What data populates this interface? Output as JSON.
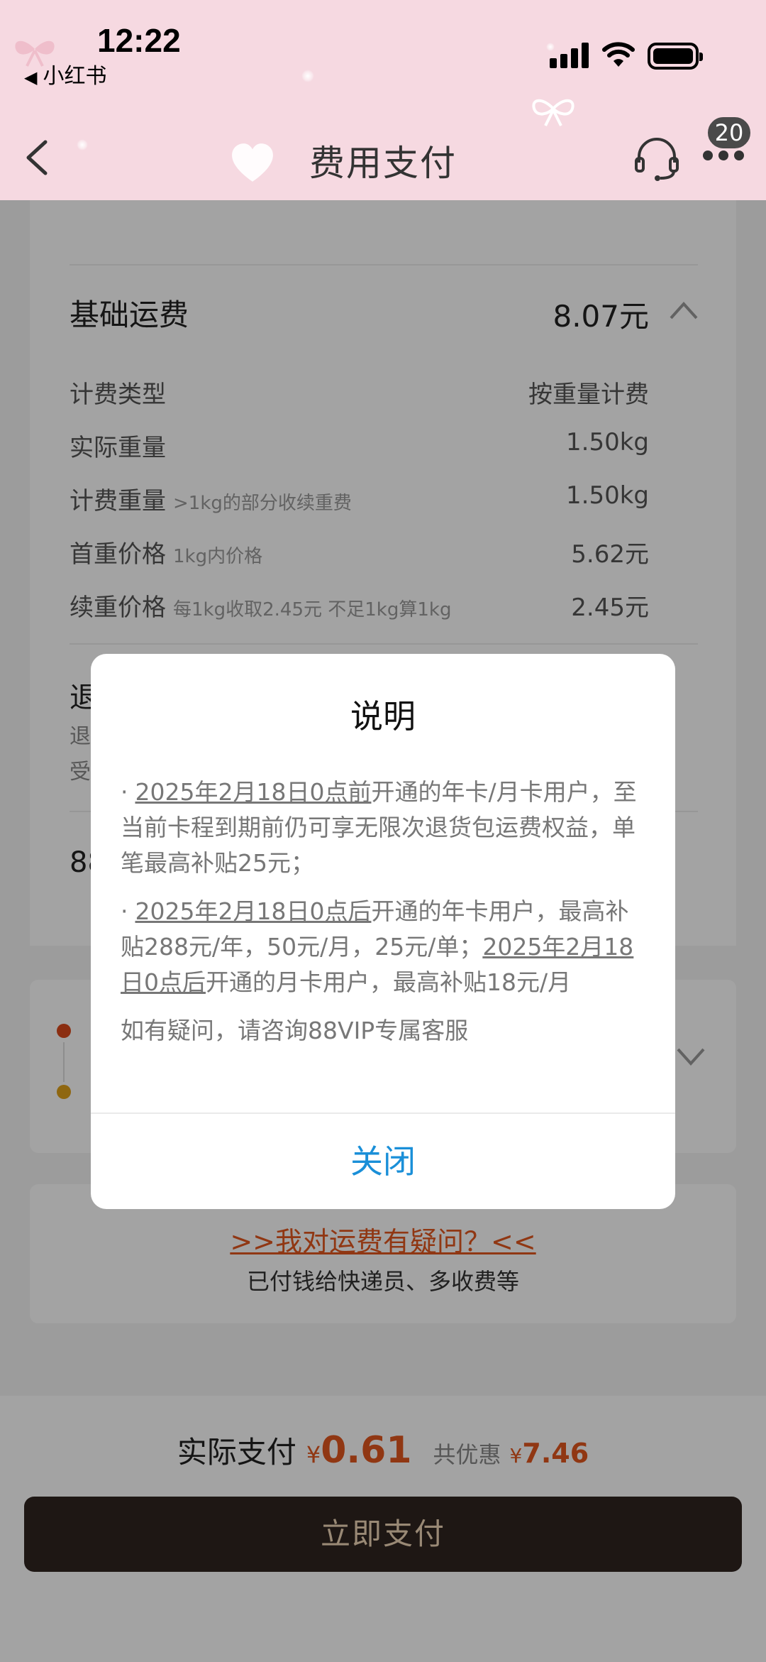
{
  "status_bar": {
    "time": "12:22",
    "back_app": "小红书"
  },
  "nav": {
    "title": "费用支付",
    "badge": "20"
  },
  "fee": {
    "base_label": "基础运费",
    "base_value": "8.07元",
    "rows": [
      {
        "label": "计费类型",
        "sub": "",
        "value": "按重量计费"
      },
      {
        "label": "实际重量",
        "sub": "",
        "value": "1.50kg"
      },
      {
        "label": "计费重量",
        "sub": ">1kg的部分收续重费",
        "value": "1.50kg"
      },
      {
        "label": "首重价格",
        "sub": "1kg内价格",
        "value": "5.62元"
      },
      {
        "label": "续重价格",
        "sub": "每1kg收取2.45元 不足1kg算1kg",
        "value": "2.45元"
      }
    ],
    "partial_heading": "退",
    "partial_line1": "退",
    "partial_line2": "受",
    "partial_88": "88"
  },
  "faq": {
    "link": ">>我对运费有疑问？<<",
    "sub": "已付钱给快递员、多收费等"
  },
  "payment": {
    "label": "实际支付",
    "currency": "¥",
    "amount": "0.61",
    "discount_label": "共优惠",
    "discount_currency": "¥",
    "discount": "7.46",
    "button": "立即支付"
  },
  "modal": {
    "title": "说明",
    "bullet": "·",
    "p1_underlined": "2025年2月18日0点前",
    "p1_rest": "开通的年卡/月卡用户，至当前卡程到期前仍可享无限次退货包运费权益，单笔最高补贴25元；",
    "p2_underlined_a": "2025年2月18日0点后",
    "p2_mid": "开通的年卡用户，最高补贴288元/年，50元/月，25元/单；",
    "p2_underlined_b": "2025年2月18日0点后",
    "p2_rest": "开通的月卡用户，最高补贴18元/月",
    "p3": "如有疑问，请咨询88VIP专属客服",
    "close": "关闭"
  },
  "colors": {
    "accent": "#e2571e",
    "link_blue": "#1a8fd8",
    "header_pink": "#f6d9e1",
    "pay_button": "#2f2420",
    "timeline_red": "#d9481c",
    "timeline_yellow": "#e0a21a"
  },
  "icons": {
    "back": "chevron-left-icon",
    "support": "headset-icon",
    "more": "more-dots-icon",
    "collapse": "chevron-up-icon",
    "expand": "chevron-down-icon"
  }
}
